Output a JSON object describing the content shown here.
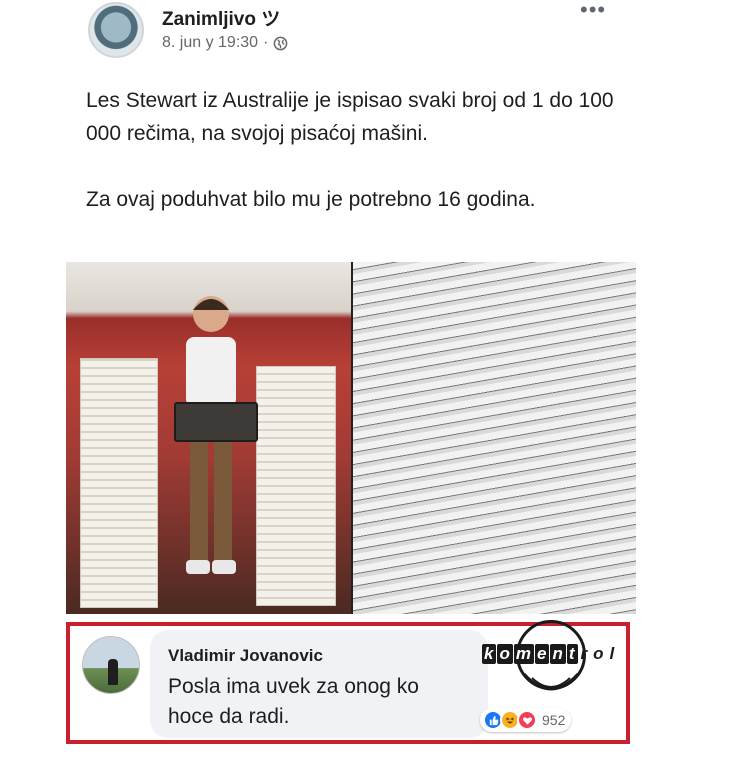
{
  "post": {
    "page_name": "Zanimljivo ツ",
    "timestamp": "8. jun у 19:30",
    "separator": "·",
    "privacy_icon": "globe-icon",
    "more_icon": "•••",
    "text_paragraphs": [
      "Les Stewart iz Australije je ispisao svaki broj od 1 do 100 000 rečima, na svojoj pisaćoj mašini.",
      "Za ovaj poduhvat bilo mu je potrebno 16 godina."
    ]
  },
  "photo": {
    "right_panel_text": "thousand, nine hundred and ninety-"
  },
  "comment": {
    "author": "Vladimir Jovanovic",
    "text": "Posla ima uvek za onog ko hoce da radi.",
    "reaction_count": "952",
    "reactions": [
      "like",
      "haha",
      "love"
    ]
  },
  "watermark": {
    "parts": [
      "k",
      "o",
      "m",
      "e",
      "n",
      "t",
      "r",
      "o",
      "l"
    ]
  },
  "colors": {
    "highlight_border": "#c8202f",
    "like": "#1877f2",
    "haha": "#f7b125",
    "love": "#f33e58"
  }
}
